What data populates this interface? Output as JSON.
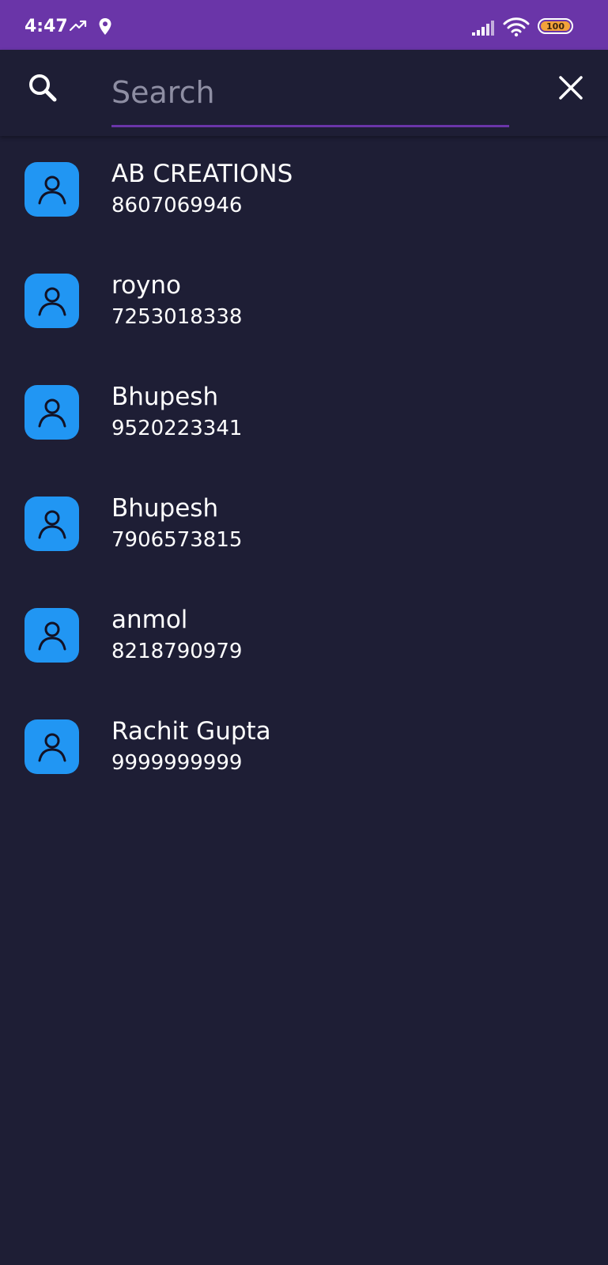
{
  "status_bar": {
    "time": "4:47",
    "battery": "100",
    "icons": [
      "trending-up-icon",
      "location-pin-icon",
      "signal-icon",
      "wifi-icon",
      "battery-icon"
    ],
    "background_color": "#6a35a8"
  },
  "search": {
    "placeholder": "Search",
    "value": "",
    "underline_color": "#6a35a8",
    "leading_icon": "search-icon",
    "trailing_icon": "close-icon"
  },
  "contacts": [
    {
      "name": "AB CREATIONS",
      "phone": "8607069946",
      "icon": "person-icon"
    },
    {
      "name": "royno",
      "phone": "7253018338",
      "icon": "person-icon"
    },
    {
      "name": "Bhupesh",
      "phone": "9520223341",
      "icon": "person-icon"
    },
    {
      "name": "Bhupesh",
      "phone": "7906573815",
      "icon": "person-icon"
    },
    {
      "name": "anmol",
      "phone": "8218790979",
      "icon": "person-icon"
    },
    {
      "name": "Rachit Gupta",
      "phone": "9999999999",
      "icon": "person-icon"
    }
  ],
  "colors": {
    "background": "#1e1e35",
    "avatar": "#2196f3",
    "text": "#ffffff",
    "placeholder": "#8e8ea3"
  }
}
